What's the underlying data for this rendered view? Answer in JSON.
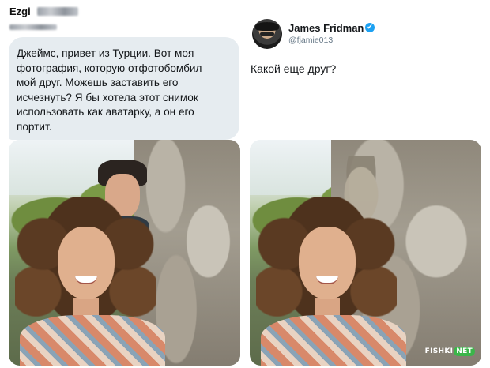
{
  "left_tweet": {
    "author_name": "Ezgi",
    "message": "Джеймс, привет из Турции. Вот моя\nфотография, которую отфотобомбил\nмой друг. Можешь заставить его\nисчезнуть? Я бы хотела этот снимок\nиспользовать как аватарку, а он его\nпортит."
  },
  "right_tweet": {
    "author_name": "James Fridman",
    "handle": "@fjamie013",
    "reply": "Какой еще друг?",
    "verified_icon": "✔"
  },
  "watermark": {
    "brand": "FISHKI",
    "suffix": "NET"
  },
  "colors": {
    "bubble_bg": "#e6ecf0",
    "verified_blue": "#1da1f2",
    "handle_gray": "#657786",
    "watermark_green": "#3bb54a"
  }
}
